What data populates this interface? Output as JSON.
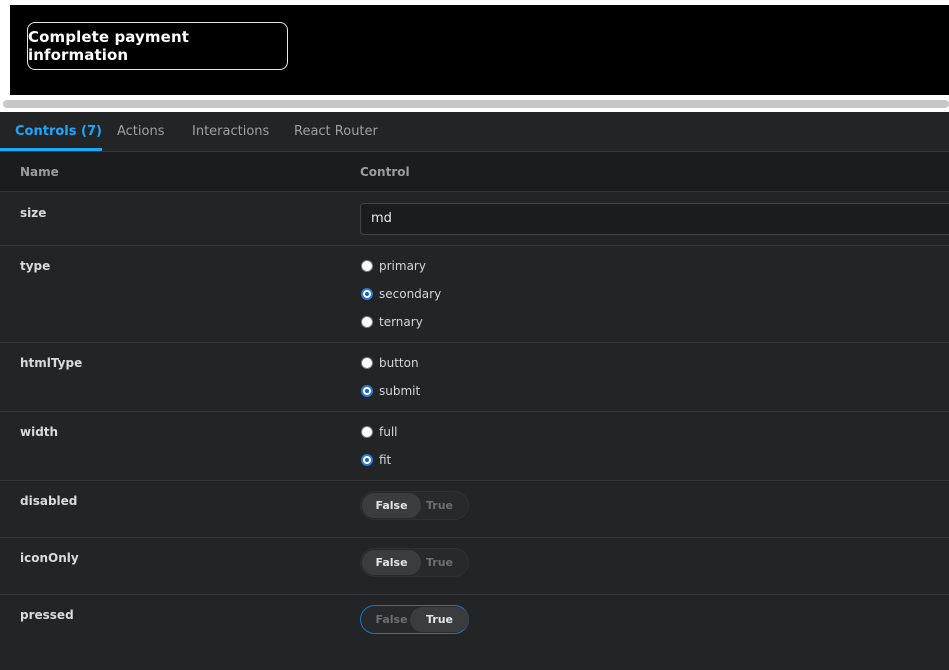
{
  "preview": {
    "button_label": "Complete payment information"
  },
  "tabs": [
    {
      "label": "Controls (7)",
      "active": true
    },
    {
      "label": "Actions"
    },
    {
      "label": "Interactions"
    },
    {
      "label": "React Router"
    }
  ],
  "table": {
    "headers": {
      "name": "Name",
      "control": "Control"
    },
    "rows": {
      "size": {
        "name": "size",
        "value": "md"
      },
      "type": {
        "name": "type",
        "options": [
          "primary",
          "secondary",
          "ternary"
        ],
        "selected": "secondary"
      },
      "htmlType": {
        "name": "htmlType",
        "options": [
          "button",
          "submit"
        ],
        "selected": "submit"
      },
      "width": {
        "name": "width",
        "options": [
          "full",
          "fit"
        ],
        "selected": "fit"
      },
      "disabled": {
        "name": "disabled",
        "false_label": "False",
        "true_label": "True",
        "value": false
      },
      "iconOnly": {
        "name": "iconOnly",
        "false_label": "False",
        "true_label": "True",
        "value": false
      },
      "pressed": {
        "name": "pressed",
        "false_label": "False",
        "true_label": "True",
        "value": true
      }
    }
  },
  "colors": {
    "accent": "#1ea7fd",
    "panel": "#222425",
    "radio_selected": "#2b7bdc"
  }
}
